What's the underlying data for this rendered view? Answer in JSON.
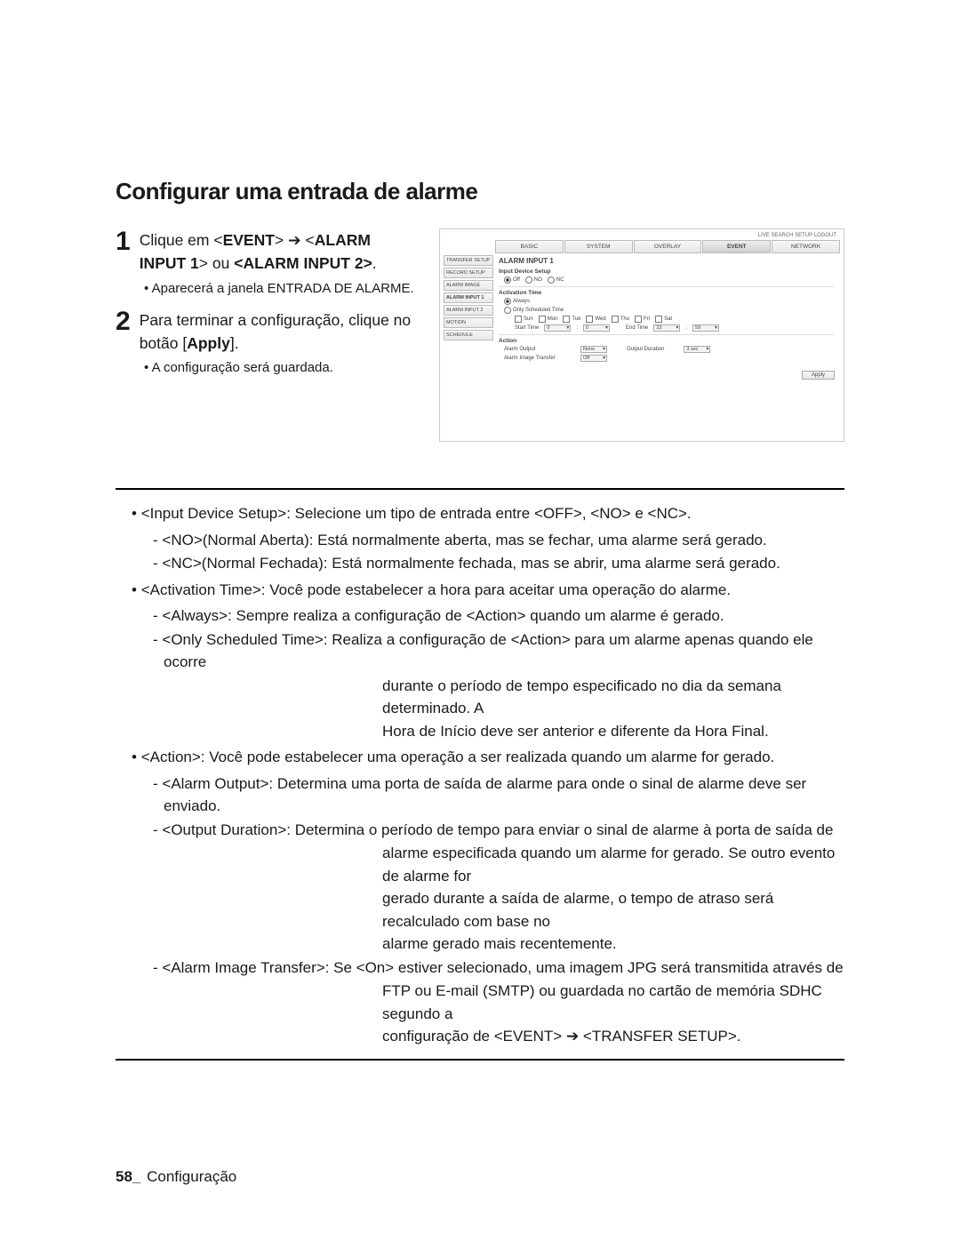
{
  "title": "Configurar uma entrada de alarme",
  "steps": {
    "s1_num": "1",
    "s1_a": "Clique em <",
    "s1_b": "EVENT",
    "s1_c": "> ",
    "s1_arrow": "➔",
    "s1_d": " <",
    "s1_e": "ALARM INPUT 1",
    "s1_f": "> ou ",
    "s1_g": "<ALARM INPUT 2>",
    "s1_h": ".",
    "s1_sub": "Aparecerá a janela ENTRADA DE ALARME.",
    "s2_num": "2",
    "s2_a": "Para terminar a configuração, clique no botão [",
    "s2_b": "Apply",
    "s2_c": "].",
    "s2_sub": "A configuração será guardada."
  },
  "ui": {
    "top_links": "LIVE  SEARCH SETUP  LOGOUT",
    "tabs": [
      "BASIC",
      "SYSTEM",
      "OVERLAY",
      "EVENT",
      "NETWORK"
    ],
    "active_tab": 3,
    "side": [
      "TRANSFER SETUP",
      "RECORD SETUP",
      "ALARM IMAGE",
      "ALARM INPUT 1",
      "ALARM INPUT 2",
      "MOTION",
      "SCHEDULE"
    ],
    "side_active": 3,
    "panel_title": "ALARM INPUT 1",
    "group_input": "Input Device Setup",
    "opt_off": "Off",
    "opt_no": "NO",
    "opt_nc": "NC",
    "group_act_time": "Activation Time",
    "opt_always": "Always",
    "opt_sched": "Only Scheduled Time",
    "days": [
      "Sun",
      "Mon",
      "Tue",
      "Wed",
      "Thu",
      "Fri",
      "Sat"
    ],
    "start_label": "Start Time",
    "end_label": "End Time",
    "t0": "0",
    "t59": "59",
    "t23": "23",
    "group_action": "Action",
    "row_alarm_out": "Alarm Output",
    "sel_none": "None",
    "row_out_dur": "Output Duration",
    "sel_3sec": "3 sec",
    "row_img_trans": "Alarm Image Transfer",
    "sel_off": "Off",
    "apply": "Apply"
  },
  "desc": {
    "l1a": "<Input Device Setup>: Selecione um tipo de entrada entre <OFF>, <NO> e <NC>.",
    "l1a1": "<NO>(Normal Aberta): Está normalmente aberta, mas se fechar, uma alarme será gerado.",
    "l1a2": "<NC>(Normal Fechada): Está normalmente fechada, mas se abrir, uma alarme será gerado.",
    "l1b": "<Activation Time>: Você pode estabelecer a hora para aceitar uma operação do alarme.",
    "l1b1": "<Always>: Sempre realiza a configuração de <Action> quando um alarme é gerado.",
    "l1b2": "<Only Scheduled Time>: Realiza a configuração de <Action> para um alarme apenas quando ele ocorre",
    "l1b2c1": "durante o período de tempo especificado no dia da semana determinado. A",
    "l1b2c2": "Hora de Início deve ser anterior e diferente da Hora Final.",
    "l1c": "<Action>: Você pode estabelecer uma operação a ser realizada quando um alarme for gerado.",
    "l1c1": "<Alarm Output>: Determina uma porta de saída de alarme para onde o sinal de alarme deve ser enviado.",
    "l1c2": "<Output Duration>: Determina o período de tempo para enviar o sinal de alarme à porta de saída de",
    "l1c2c1": "alarme especificada quando um alarme for gerado. Se outro evento de alarme for",
    "l1c2c2": "gerado durante a saída de alarme, o tempo de atraso será recalculado com base no",
    "l1c2c3": "alarme gerado mais recentemente.",
    "l1c3": "<Alarm Image Transfer>: Se <On> estiver selecionado, uma imagem JPG será transmitida através de",
    "l1c3c1": "FTP ou E-mail (SMTP) ou guardada no cartão de memória SDHC segundo a",
    "l1c3c2": "configuração de <EVENT>  ➔  <TRANSFER SETUP>."
  },
  "footer": {
    "page": "58",
    "sep": "_",
    "label": "Configuração"
  }
}
